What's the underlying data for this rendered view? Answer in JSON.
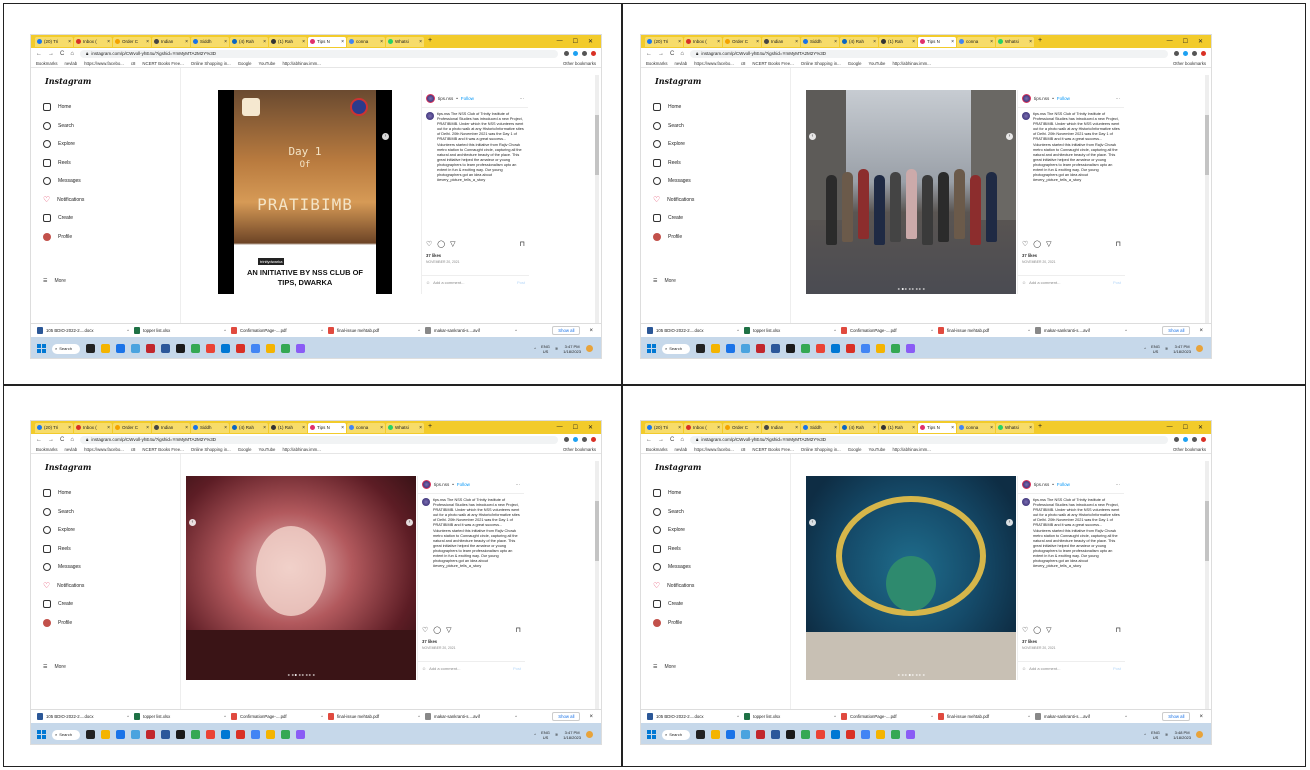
{
  "browser": {
    "tabs": [
      "(20) Tri",
      "Inbox (",
      "Order C",
      "Indian",
      "Siddh",
      "(4) Rah",
      "(1) Rah",
      "Tips N",
      "conna",
      "Whatsi"
    ],
    "active_tab_index": 7,
    "url": "instagram.com/p/CWvoll-yhE4u/?igshid=YmMyMTA2M2Y%3D",
    "bookmarks": [
      "Bookmarks",
      "nevlab",
      "https://www.facebo...",
      "c8",
      "NCERT Books Free...",
      "Online Shopping in...",
      "Google",
      "YouTube",
      "http://abhinav.imm..."
    ],
    "other_bookmarks": "Other bookmarks"
  },
  "instagram": {
    "logo": "Instagram",
    "menu": [
      "Home",
      "Search",
      "Explore",
      "Reels",
      "Messages",
      "Notifications",
      "Create",
      "Profile"
    ],
    "more": "More"
  },
  "post": {
    "username": "tips.nss",
    "follow": "Follow",
    "caption": "tips.nss The NSS Club of Trinity Institute of Professional Studies has introduced a new Project, PRATIBIMB. Under which the NSS volunteers went out for a photo walk at any Historic/informative sites of Delhi. 20th November 2021 was the Day 1 of PRATIBIMB and it was a great success... Volunteers started this initiative from Rajiv Chowk metro station to Connaught circle, capturing all the natural and architecture beauty of the place. This great initiative helped the amateur or young photographers to learn professionalism upto an extent in fun & exciting way. Our young photographers got an idea about #every_picture_tells_a_story",
    "likes": "37 likes",
    "date": "NOVEMBER 20, 2021",
    "comment_placeholder": "Add a comment...",
    "post_label": "Post"
  },
  "slides": {
    "s1": {
      "day": "Day 1",
      "of": "Of",
      "project": "PRATIBIMB",
      "tag": "trinitydwarka",
      "line1": "AN INITIATIVE BY NSS CLUB OF",
      "line2": "TIPS, DWARKA"
    }
  },
  "downloads": [
    {
      "name": "105 BDIO-2022-2....docx",
      "color": "#2b5797"
    },
    {
      "name": "topper list.xlsx",
      "color": "#1e7145"
    },
    {
      "name": "ConfirmationPage-....pdf",
      "color": "#e04a3f"
    },
    {
      "name": "final-issue mehtab.pdf",
      "color": "#e04a3f"
    },
    {
      "name": "makar-sankranti-s....avif",
      "color": "#888888"
    }
  ],
  "show_all": "Show all",
  "taskbar": {
    "search": "Search",
    "lang1": "ENG",
    "lang2": "US",
    "times": [
      "3:47 PM",
      "3:47 PM",
      "3:47 PM",
      "3:48 PM"
    ],
    "date": "1/18/2023"
  }
}
